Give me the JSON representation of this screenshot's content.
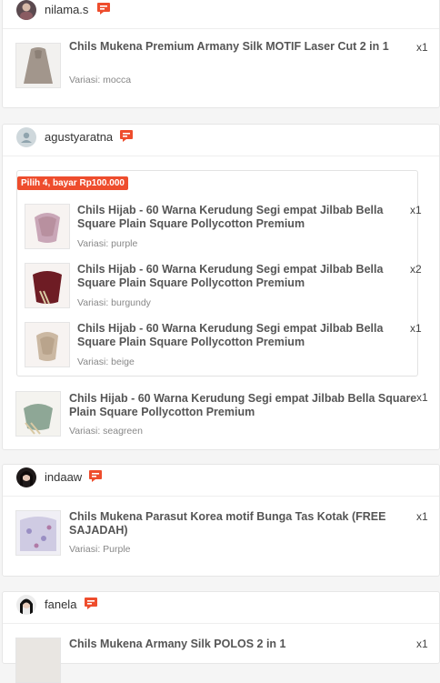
{
  "orders": [
    {
      "user": "nilama.s",
      "items": [
        {
          "title": "Chils Mukena Premium Armany Silk MOTIF Laser Cut 2 in 1",
          "variant": "Variasi: mocca",
          "qty": "x1"
        }
      ]
    },
    {
      "user": "agustyaratna",
      "promo": "Pilih 4, bayar Rp100.000",
      "bundle_items": [
        {
          "title": "Chils Hijab - 60 Warna Kerudung Segi empat Jilbab Bella Square Plain Square Pollycotton Premium",
          "variant": "Variasi: purple",
          "qty": "x1"
        },
        {
          "title": "Chils Hijab - 60 Warna Kerudung Segi empat Jilbab Bella Square Plain Square Pollycotton Premium",
          "variant": "Variasi: burgundy",
          "qty": "x2"
        },
        {
          "title": "Chils Hijab - 60 Warna Kerudung Segi empat Jilbab Bella Square Plain Square Pollycotton Premium",
          "variant": "Variasi: beige",
          "qty": "x1"
        }
      ],
      "items": [
        {
          "title": "Chils Hijab - 60 Warna Kerudung Segi empat Jilbab Bella Square Plain Square Pollycotton Premium",
          "variant": "Variasi: seagreen",
          "qty": "x1"
        }
      ]
    },
    {
      "user": "indaaw",
      "items": [
        {
          "title": "Chils Mukena Parasut Korea motif Bunga Tas Kotak (FREE SAJADAH)",
          "variant": "Variasi: Purple",
          "qty": "x1"
        }
      ]
    },
    {
      "user": "fanela",
      "items": [
        {
          "title": "Chils Mukena Armany Silk POLOS 2 in 1",
          "variant": "",
          "qty": "x1"
        }
      ]
    }
  ],
  "icons": {
    "chat": "chat-bubble-icon",
    "default_avatar": "user-silhouette-icon"
  },
  "colors": {
    "accent": "#ee4d2d",
    "swatch_mocca": "#a2968c",
    "swatch_purple": "#c9a6b7",
    "swatch_burgundy": "#6e1c24",
    "swatch_beige": "#cbb8a2",
    "swatch_seagreen": "#8ea796",
    "swatch_floral": "#cfcbe3"
  }
}
